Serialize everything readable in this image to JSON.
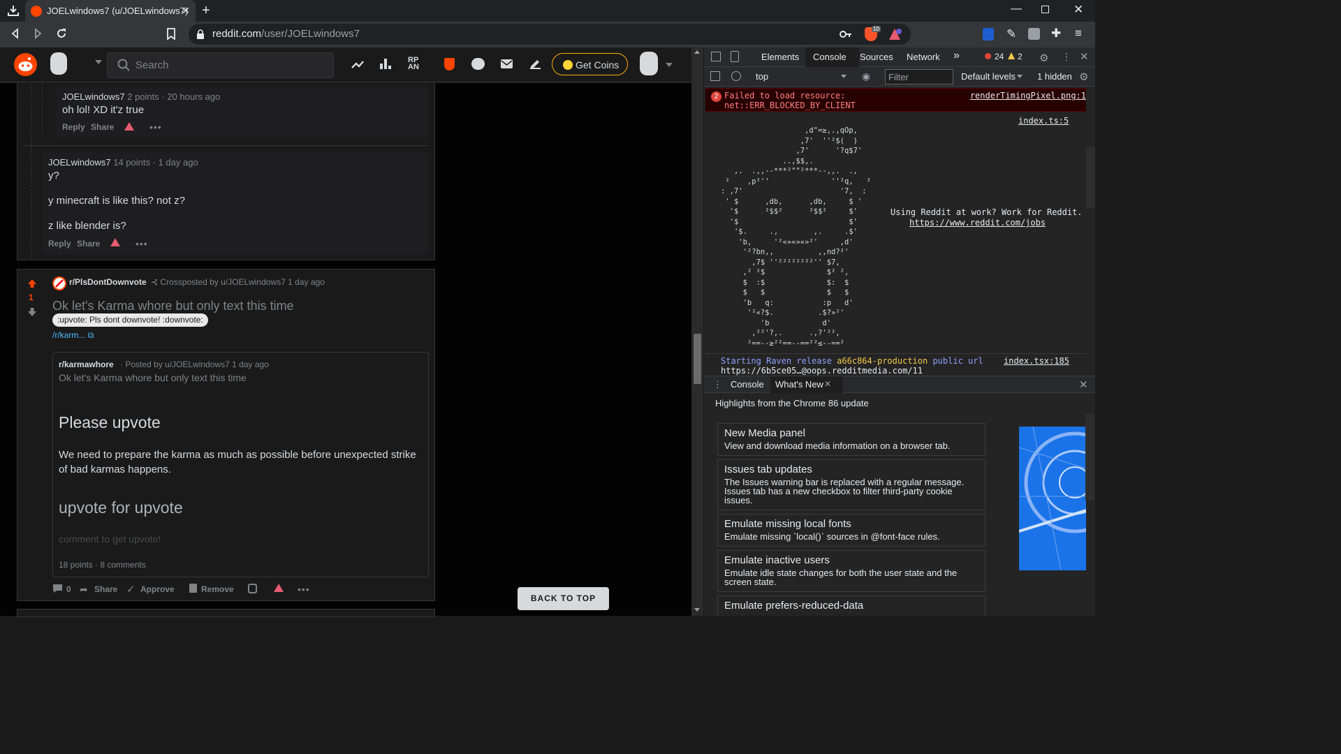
{
  "browser": {
    "tab_title": "JOELwindows7 (u/JOELwindows7)",
    "url_host": "reddit.com",
    "url_path": "/user/JOELwindows7",
    "ext_badges": [
      "10"
    ]
  },
  "reddit": {
    "search_placeholder": "Search",
    "get_coins": "Get Coins",
    "comment1": {
      "author": "JOELwindows7",
      "meta": "2 points · 20 hours ago",
      "body": "oh lol! XD it'z true",
      "reply": "Reply",
      "share": "Share"
    },
    "comment2": {
      "author": "JOELwindows7",
      "meta": "14 points · 1 day ago",
      "lines": [
        "y?",
        "y minecraft is like this? not z?",
        "z like blender is?"
      ],
      "reply": "Reply",
      "share": "Share"
    },
    "post": {
      "vote_count": "1",
      "subreddit": "r/PlsDontDownvote",
      "crosspost_label": "Crossposted by u/JOELwindows7 1 day ago",
      "title": "Ok let's Karma whore but only text this time",
      "flair": ":upvote: Pls dont downvote! :downvote:",
      "link": "/r/karm...",
      "inner": {
        "subreddit": "r/karmawhore",
        "posted_by": "· Posted by u/JOELwindows7 1 day ago",
        "title": "Ok let's Karma whore but only text this time",
        "heading1": "Please upvote",
        "paragraph_lines": [
          "We need to prepare the karma as much as possible before unexpected strike",
          "of bad karmas happens."
        ],
        "heading2": "upvote for upvote",
        "faded": "comment to get upvote!",
        "stats": "18 points · 8 comments"
      },
      "actions": {
        "comments_count": "0",
        "share": "Share",
        "approve": "Approve",
        "remove": "Remove"
      }
    },
    "back_to_top": "BACK TO TOP"
  },
  "devtools": {
    "tabs": [
      "Elements",
      "Console",
      "Sources",
      "Network"
    ],
    "more_tabs": "»",
    "error_count": "24",
    "warning_count": "2",
    "context": "top",
    "filter_placeholder": "Filter",
    "levels": "Default levels",
    "hidden": "1 hidden",
    "error_badge": "2",
    "error_message": "Failed to load resource:\nnet::ERR_BLOCKED_BY_CLIENT",
    "error_source": "renderTimingPixel.png:1",
    "ascii_source": "index.ts:5",
    "ascii_art": "                   ,d\"=≥,.,qOp,\n                  ,7'  ''²$(  )\n                 ,7'      '?q$7'\n              ..,$$,.\n   ,.  .,,--***²\"\"²***--,,.  .,\n ²    ,p²''              ''²q,   ²\n: ,7'                      '7,  :\n ' $      ,db,      ,db,     $ '\n  '$      ²$$²      ²$$²     $'\n  '$                         $'\n   '$.     .,        ,.     .$'\n    'b,     '²«»«»«»²'     ,d'\n     '²?bn,,          ,,nd?²'\n       ,7$ ''²²²²²²²²'' $7,\n     ,² ²$              $² ²,\n     $  :$              $:  $\n     $   $              $   $\n     'b   q:           :p   d'\n      '²«?$.          .$?»²'\n         'b            d'\n       ,²²'?,.      .,?'²²,\n      ²==--≥²²==--==²²≤--==²",
    "jobs_line1": "Using Reddit at work? Work for Reddit.",
    "jobs_line2": "https://www.reddit.com/jobs",
    "raven_prefix": "Starting Raven release ",
    "raven_release": "a66c864-production",
    "raven_suffix": " public url",
    "raven_url": "https://6b5ce05…@oops.redditmedia.com/11",
    "raven_source": "index.tsx:185",
    "drawer": {
      "tab_console": "Console",
      "tab_whats_new": "What's New",
      "title": "Highlights from the Chrome 86 update",
      "items": [
        {
          "heading": "New Media panel",
          "desc": "View and download media information on a browser tab."
        },
        {
          "heading": "Issues tab updates",
          "desc": "The Issues warning bar is replaced with a regular message. Issues tab has a new checkbox to filter third-party cookie issues."
        },
        {
          "heading": "Emulate missing local fonts",
          "desc": "Emulate missing `local()` sources in @font-face rules."
        },
        {
          "heading": "Emulate inactive users",
          "desc": "Emulate idle state changes for both the user state and the screen state."
        },
        {
          "heading": "Emulate prefers-reduced-data",
          "desc": ""
        }
      ]
    }
  },
  "colors": {
    "reddit_orange": "#ff4500",
    "upvote": "#ff4500",
    "coins_border": "#ffb000",
    "error_red": "#e0463c",
    "link_blue": "#4fbcff"
  }
}
